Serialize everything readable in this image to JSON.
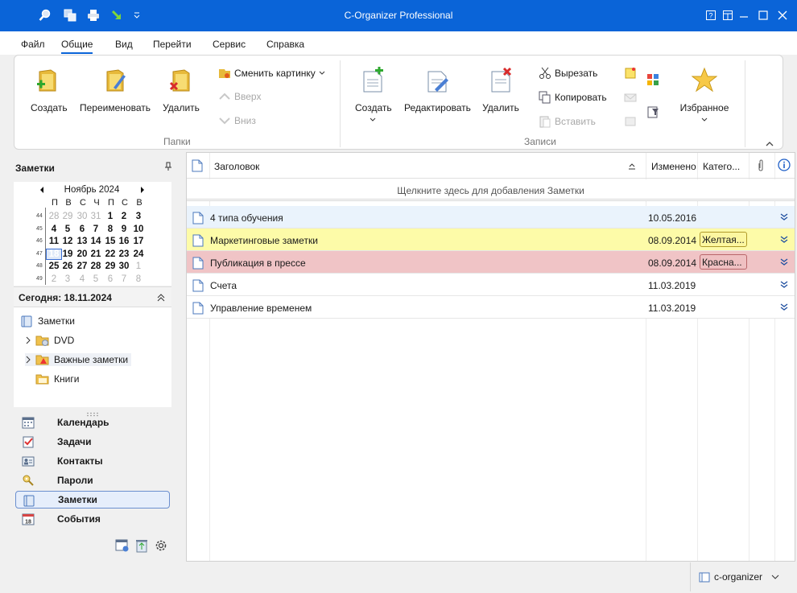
{
  "window": {
    "title": "C-Organizer Professional"
  },
  "menu": [
    "Файл",
    "Общие",
    "Вид",
    "Перейти",
    "Сервис",
    "Справка"
  ],
  "ribbon": {
    "folders": {
      "label": "Папки",
      "create": "Создать",
      "rename": "Переименовать",
      "delete": "Удалить",
      "change_picture": "Сменить картинку",
      "up": "Вверх",
      "down": "Вниз"
    },
    "records": {
      "label": "Записи",
      "create": "Создать",
      "edit": "Редактировать",
      "delete": "Удалить",
      "cut": "Вырезать",
      "copy": "Копировать",
      "paste": "Вставить",
      "favorites": "Избранное"
    }
  },
  "sidebar": {
    "title": "Заметки",
    "calendar": {
      "month": "Ноябрь 2024",
      "weekdays": [
        "П",
        "В",
        "С",
        "Ч",
        "П",
        "С",
        "В"
      ],
      "weeks": [
        {
          "num": "44",
          "days": [
            "28",
            "29",
            "30",
            "31",
            "1",
            "2",
            "3"
          ]
        },
        {
          "num": "45",
          "days": [
            "4",
            "5",
            "6",
            "7",
            "8",
            "9",
            "10"
          ]
        },
        {
          "num": "46",
          "days": [
            "11",
            "12",
            "13",
            "14",
            "15",
            "16",
            "17"
          ]
        },
        {
          "num": "47",
          "days": [
            "18",
            "19",
            "20",
            "21",
            "22",
            "23",
            "24"
          ]
        },
        {
          "num": "48",
          "days": [
            "25",
            "26",
            "27",
            "28",
            "29",
            "30",
            "1"
          ]
        },
        {
          "num": "49",
          "days": [
            "2",
            "3",
            "4",
            "5",
            "6",
            "7",
            "8"
          ]
        }
      ]
    },
    "today": "Сегодня: 18.11.2024",
    "tree": {
      "root": "Заметки",
      "items": [
        "DVD",
        "Важные заметки",
        "Книги"
      ]
    },
    "nav": [
      "Календарь",
      "Задачи",
      "Контакты",
      "Пароли",
      "Заметки",
      "События"
    ]
  },
  "grid": {
    "headers": {
      "title": "Заголовок",
      "modified": "Изменено",
      "category": "Катего..."
    },
    "add_hint": "Щелкните здесь для добавления Заметки",
    "rows": [
      {
        "title": "4 типа обучения",
        "modified": "10.05.2016",
        "category": ""
      },
      {
        "title": "Маркетинговые заметки",
        "modified": "08.09.2014",
        "category": "Желтая..."
      },
      {
        "title": "Публикация в прессе",
        "modified": "08.09.2014",
        "category": "Красна..."
      },
      {
        "title": "Счета",
        "modified": "11.03.2019",
        "category": ""
      },
      {
        "title": "Управление временем",
        "modified": "11.03.2019",
        "category": ""
      }
    ]
  },
  "status": {
    "database": "c-organizer"
  },
  "colors": {
    "accent": "#0a64d8",
    "row_blue": "#eaf3fc",
    "row_yellow": "#fdfba8",
    "row_red": "#f0c4c6"
  }
}
